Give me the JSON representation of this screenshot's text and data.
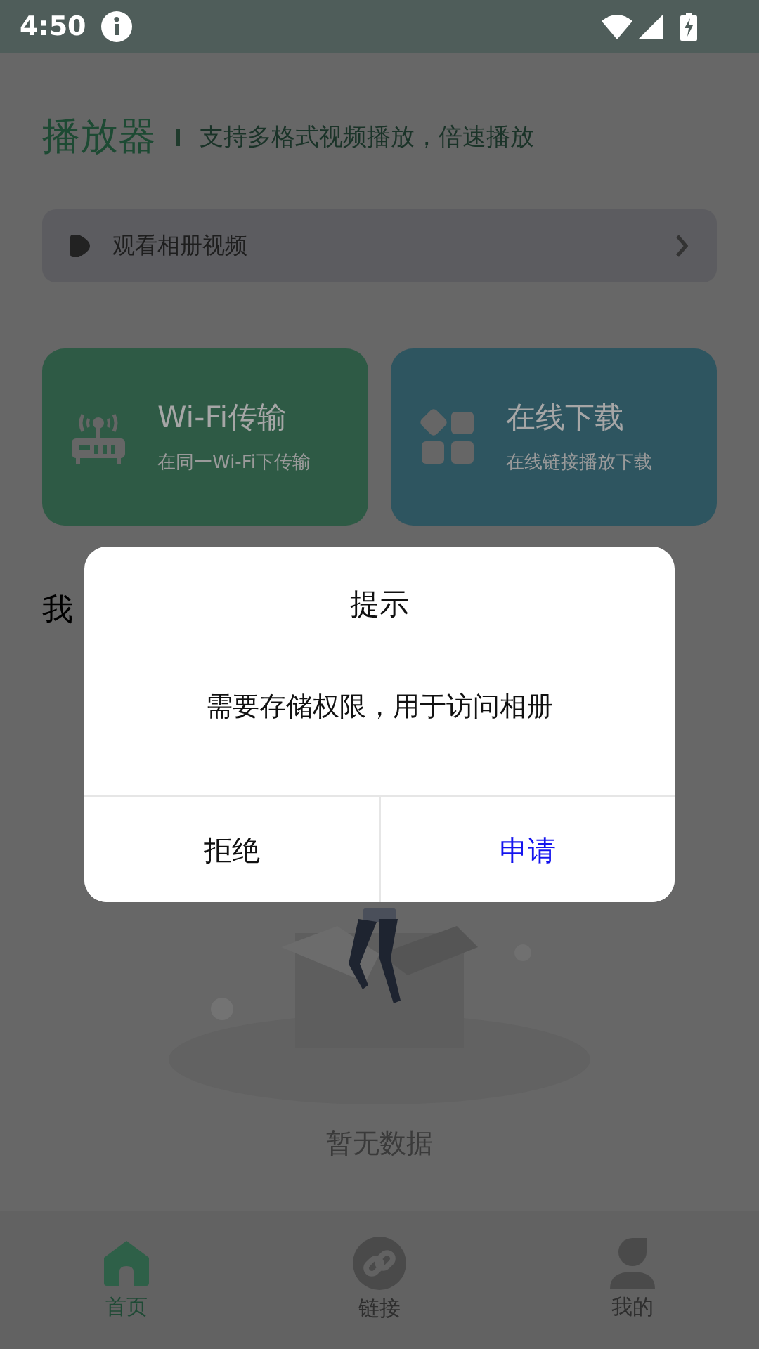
{
  "status_bar": {
    "time": "4:50"
  },
  "header": {
    "title": "播放器",
    "subtitle": "支持多格式视频播放，倍速播放"
  },
  "album_button": {
    "label": "观看相册视频"
  },
  "feature_cards": [
    {
      "kind": "wifi",
      "title": "Wi-Fi传输",
      "subtitle": "在同一Wi-Fi下传输",
      "color": "#2e5a45"
    },
    {
      "kind": "download",
      "title": "在线下载",
      "subtitle": "在线链接播放下载",
      "color": "#2e5560"
    }
  ],
  "section_title": "我",
  "empty_state": {
    "text": "暂无数据"
  },
  "dialog": {
    "title": "提示",
    "message": "需要存储权限，用于访问相册",
    "buttons": [
      {
        "label": "拒绝",
        "kind": "cancel"
      },
      {
        "label": "申请",
        "kind": "confirm"
      }
    ]
  },
  "bottom_nav": [
    {
      "label": "首页",
      "selected": true
    },
    {
      "label": "链接",
      "selected": false
    },
    {
      "label": "我的",
      "selected": false
    }
  ]
}
